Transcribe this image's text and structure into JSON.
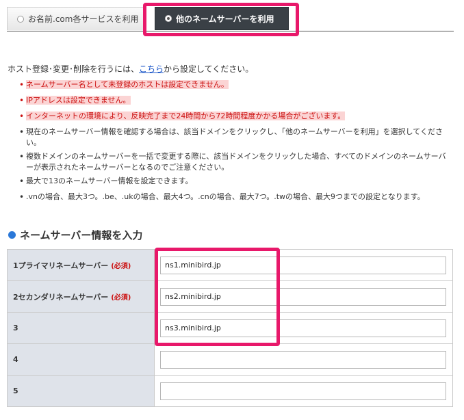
{
  "tabs": {
    "inactive_label": "お名前.com各サービスを利用",
    "active_label": "他のネームサーバーを利用"
  },
  "intro": {
    "prefix": "ホスト登録･変更･削除を行うには、",
    "link": "こちら",
    "suffix": "から設定してください。"
  },
  "notes": [
    "ネームサーバー名として未登録のホストは設定できません。",
    "IPアドレスは設定できません。",
    "インターネットの環境により、反映完了まで24時間から72時間程度かかる場合がございます。",
    "現在のネームサーバー情報を確認する場合は、該当ドメインをクリックし、「他のネームサーバーを利用」を選択してください。",
    "複数ドメインのネームサーバーを一括で変更する際に、該当ドメインをクリックした場合、すべてのドメインのネームサーバーが表示されたネームサーバーとなるのでご注意ください。",
    "最大で13のネームサーバー情報を設定できます。",
    ".vnの場合、最大3つ。.be、.ukの場合、最大4つ。.cnの場合、最大7つ。.twの場合、最大9つまでの設定となります。"
  ],
  "section": {
    "title": "ネームサーバー情報を入力"
  },
  "form": {
    "required_label": "(必須)",
    "rows": [
      {
        "label": "1プライマリネームサーバー",
        "value": "ns1.minibird.jp"
      },
      {
        "label": "2セカンダリネームサーバー",
        "value": "ns2.minibird.jp"
      },
      {
        "label": "3",
        "value": "ns3.minibird.jp"
      },
      {
        "label": "4",
        "value": ""
      },
      {
        "label": "5",
        "value": ""
      }
    ]
  },
  "colors": {
    "highlight": "#e8186a",
    "active_tab": "#3a4046",
    "warning_text": "#cc1111",
    "warning_bg": "#fbd4d4",
    "link": "#1a55c8",
    "label_cell_bg": "#dfe3ea",
    "heading_dot": "#2a78d8"
  }
}
